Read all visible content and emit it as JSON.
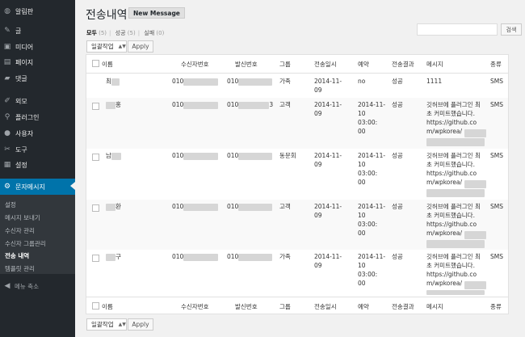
{
  "sidebar": {
    "items": [
      {
        "label": "알림판",
        "icon": "dashboard-icon"
      },
      {
        "label": "글",
        "icon": "pin-icon"
      },
      {
        "label": "미디어",
        "icon": "media-icon"
      },
      {
        "label": "페이지",
        "icon": "page-icon"
      },
      {
        "label": "댓글",
        "icon": "comment-icon"
      },
      {
        "label": "외모",
        "icon": "brush-icon"
      },
      {
        "label": "플러그인",
        "icon": "plugin-icon"
      },
      {
        "label": "사용자",
        "icon": "user-icon"
      },
      {
        "label": "도구",
        "icon": "wrench-icon"
      },
      {
        "label": "설정",
        "icon": "settings-icon"
      },
      {
        "label": "문자메시지",
        "icon": "gear-icon"
      }
    ],
    "submenu": [
      "설정",
      "메시지 보내기",
      "수신자 관리",
      "수신자 그룹관리",
      "전송 내역",
      "템플릿 관리"
    ],
    "collapse_label": "메뉴 축소"
  },
  "header": {
    "title": "전송내역",
    "new_button": "New Message"
  },
  "filters": {
    "all": "모두",
    "all_count": "(5)",
    "success": "성공",
    "success_count": "(5)",
    "fail": "실패",
    "fail_count": "(0)"
  },
  "search": {
    "button": "검색",
    "value": ""
  },
  "bulk": {
    "select_label": "일괄작업",
    "apply_label": "Apply"
  },
  "table": {
    "columns": [
      "이름",
      "수신자번호",
      "발신번호",
      "그룹",
      "전송일시",
      "예약",
      "전송결과",
      "메시지",
      "종류"
    ],
    "rows": [
      {
        "name": "최",
        "to": "010",
        "from": "010",
        "group": "가족",
        "date": "2014-11-\n09",
        "reserve": "no",
        "result": "성공",
        "message": "1111",
        "type": "SMS"
      },
      {
        "name": "",
        "name2": "홍",
        "to": "010",
        "from": "010",
        "from2": "3",
        "group": "고객",
        "date": "2014-11-\n09",
        "reserve": "2014-11-\n10\n03:00:\n00",
        "result": "성공",
        "message": "깃허브에 플러그인 최\n초 커미트했습니다.\nhttps://github.co\nm/wpkorea/",
        "type": "SMS"
      },
      {
        "name": "남",
        "to": "010",
        "from": "010",
        "group": "동문회",
        "date": "2014-11-\n09",
        "reserve": "2014-11-\n10\n03:00:\n00",
        "result": "성공",
        "message": "깃허브에 플러그인 최\n초 커미트했습니다.\nhttps://github.co\nm/wpkorea/",
        "type": "SMS"
      },
      {
        "name": "",
        "name2": "환",
        "to": "010",
        "from": "010",
        "group": "고객",
        "date": "2014-11-\n09",
        "reserve": "2014-11-\n10\n03:00:\n00",
        "result": "성공",
        "message": "깃허브에 플러그인 최\n초 커미트했습니다.\nhttps://github.co\nm/wpkorea/",
        "type": "SMS"
      },
      {
        "name": "",
        "name2": "구",
        "to": "010",
        "from": "010",
        "group": "가족",
        "date": "2014-11-\n09",
        "reserve": "2014-11-\n10\n03:00:\n00",
        "result": "성공",
        "message": "깃허브에 플러그인 최\n초 커미트했습니다.\nhttps://github.co\nm/wpkorea/",
        "type": "SMS"
      }
    ]
  }
}
